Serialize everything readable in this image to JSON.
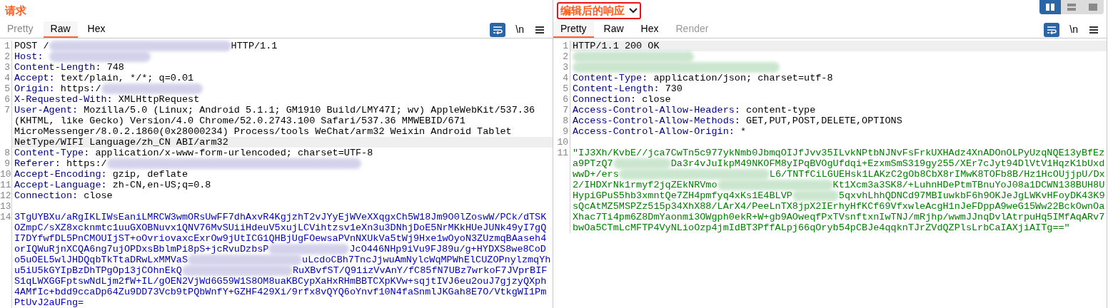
{
  "panes": [
    {
      "title": "请求",
      "title_boxed": false,
      "tabs": [
        {
          "label": "Pretty",
          "selected": false,
          "disabled": false
        },
        {
          "label": "Raw",
          "selected": true,
          "disabled": false
        },
        {
          "label": "Hex",
          "selected": false,
          "disabled": false
        }
      ],
      "toolbar": {
        "wrap_on": true,
        "newline": "\\n"
      },
      "lines": [
        {
          "number": "1",
          "highlighted": false,
          "rows": [
            [
              {
                "kind": "text",
                "text": "POST /"
              },
              {
                "kind": "redacted"
              },
              {
                "kind": "text",
                "text": "HTTP/1.1"
              }
            ]
          ]
        },
        {
          "number": "2",
          "highlighted": false,
          "rows": [
            [
              {
                "kind": "name",
                "text": "Host: "
              },
              {
                "kind": "redacted"
              }
            ]
          ]
        },
        {
          "number": "3",
          "highlighted": false,
          "rows": [
            [
              {
                "kind": "name",
                "text": "Content-Length: "
              },
              {
                "kind": "text",
                "text": "748"
              }
            ]
          ]
        },
        {
          "number": "4",
          "highlighted": false,
          "rows": [
            [
              {
                "kind": "name",
                "text": "Accept: "
              },
              {
                "kind": "text",
                "text": "text/plain, */*; q=0.01"
              }
            ]
          ]
        },
        {
          "number": "5",
          "highlighted": false,
          "rows": [
            [
              {
                "kind": "name",
                "text": "Origin: "
              },
              {
                "kind": "text",
                "text": "https:/"
              },
              {
                "kind": "redacted"
              }
            ]
          ]
        },
        {
          "number": "6",
          "highlighted": false,
          "rows": [
            [
              {
                "kind": "name",
                "text": "X-Requested-With: "
              },
              {
                "kind": "text",
                "text": "XMLHttpRequest"
              }
            ]
          ]
        },
        {
          "number": "7",
          "highlighted": true,
          "rows": [
            [
              {
                "kind": "name",
                "text": "User-Agent: "
              },
              {
                "kind": "text",
                "text": "Mozilla/5.0 (Linux; Android 5.1.1; GM1910 Build/LMY47I; wv) AppleWebKit/537.36"
              }
            ],
            [
              {
                "kind": "text",
                "text": "(KHTML, like Gecko) Version/4.0 Chrome/52.0.2743.100 Safari/537.36 MMWEBID/671"
              }
            ],
            [
              {
                "kind": "text",
                "text": "MicroMessenger/8.0.2.1860(0x28000234) Process/tools WeChat/arm32 Weixin Android Tablet"
              }
            ],
            [
              {
                "kind": "text",
                "text": "NetType/WIFI Language/zh_CN ABI/arm32"
              }
            ]
          ]
        },
        {
          "number": "8",
          "highlighted": false,
          "rows": [
            [
              {
                "kind": "name",
                "text": "Content-Type: "
              },
              {
                "kind": "text",
                "text": "application/x-www-form-urlencoded; charset=UTF-8"
              }
            ]
          ]
        },
        {
          "number": "9",
          "highlighted": false,
          "rows": [
            [
              {
                "kind": "name",
                "text": "Referer: "
              },
              {
                "kind": "text",
                "text": "https:/"
              },
              {
                "kind": "redacted"
              }
            ]
          ]
        },
        {
          "number": "10",
          "highlighted": false,
          "rows": [
            [
              {
                "kind": "name",
                "text": "Accept-Encoding: "
              },
              {
                "kind": "text",
                "text": "gzip, deflate"
              }
            ]
          ]
        },
        {
          "number": "11",
          "highlighted": false,
          "rows": [
            [
              {
                "kind": "name",
                "text": "Accept-Language: "
              },
              {
                "kind": "text",
                "text": "zh-CN,en-US;q=0.8"
              }
            ]
          ]
        },
        {
          "number": "12",
          "highlighted": false,
          "rows": [
            [
              {
                "kind": "name",
                "text": "Connection: "
              },
              {
                "kind": "text",
                "text": "close"
              }
            ]
          ]
        },
        {
          "number": "13",
          "highlighted": false,
          "rows": [
            []
          ]
        },
        {
          "number": "14",
          "highlighted": false,
          "rows": [
            [
              {
                "kind": "body",
                "text": "3TgUYBXu/aRgIKLIWsEaniLMRCW3wmORsUwFF7dhAxvR4KgjzhT2vJYyEjWVeXXqgxCh5W18Jm9O0lZoswW/PCk/dTSK"
              }
            ],
            [
              {
                "kind": "body",
                "text": "OZmpC/sXZ8xcknmtc1uuGXOBNuvx1QNV76MvSUiiHdeuV5xujLCVihtzsv1eXn3u3DNhjDoE5NrMKkHUeJUNk49yI7gQ"
              }
            ],
            [
              {
                "kind": "body",
                "text": "I7DYfwfDL5PnCMOUIjST+oOvriovaxcExrOw9jUtICG1QHBjUgFOewsaPVnNXUkVa5tWj9Hxe1wOyoN3ZUzmqBAaseh4"
              }
            ],
            [
              {
                "kind": "body",
                "text": "orIQWuRjnXCQA6ng7ujOPDxsBblmPi8pS+jcRvuDzbsP"
              },
              {
                "kind": "redacted"
              },
              {
                "kind": "body",
                "text": "JcO446NHp9iVu9FJ89u/g+HYDXS8we8CoD"
              }
            ],
            [
              {
                "kind": "body",
                "text": "o5uOEL5wlJHDQqbTkTtaDRwLxMMVaS"
              },
              {
                "kind": "redacted"
              },
              {
                "kind": "body",
                "text": "uLcdoCBh7TncJjwuAmNylcWqMPWhElCUZOPnylzmqYh"
              }
            ],
            [
              {
                "kind": "body",
                "text": "u5iU5kGYIpBzDhTPgOp13jCOhnEkQ"
              },
              {
                "kind": "redacted"
              },
              {
                "kind": "body",
                "text": "RuXBvfST/Q91izVvAnY/fC85fN7UBz7wrkoF7JVprBIF"
              }
            ],
            [
              {
                "kind": "body",
                "text": "S1qLWXGGFptswNdLjm2fW+IL/gOEN2VjWd6G59W1S8OM8uaKBCypXaHxRHmBBTCXpKVw+sqjtIVJ6eu2ouJ7gjzyQXph"
              }
            ],
            [
              {
                "kind": "body",
                "text": "4AMfIc+bdd9ccaDp64Zu9DD73Vcb9tPQbWnfY+GZHF429Xi/9rfx8vQYQ6oYnvf10N4faSnmlJKGah8E7O/VtkgWI1Pm"
              }
            ],
            [
              {
                "kind": "body",
                "text": "PtUvJ2aUFng="
              }
            ]
          ]
        }
      ]
    },
    {
      "title": "编辑后的响应",
      "title_boxed": true,
      "tabs": [
        {
          "label": "Pretty",
          "selected": true,
          "disabled": false
        },
        {
          "label": "Raw",
          "selected": false,
          "disabled": false
        },
        {
          "label": "Hex",
          "selected": false,
          "disabled": false
        },
        {
          "label": "Render",
          "selected": false,
          "disabled": true
        }
      ],
      "toolbar": {
        "wrap_on": true,
        "newline": "\\n"
      },
      "lines": [
        {
          "number": "1",
          "highlighted": true,
          "rows": [
            [
              {
                "kind": "text",
                "text": "HTTP/1.1 200 OK"
              }
            ]
          ]
        },
        {
          "number": "2",
          "highlighted": false,
          "rows": [
            [
              {
                "kind": "redacted"
              }
            ]
          ]
        },
        {
          "number": "3",
          "highlighted": false,
          "rows": [
            [
              {
                "kind": "redacted"
              }
            ]
          ]
        },
        {
          "number": "4",
          "highlighted": false,
          "rows": [
            [
              {
                "kind": "name",
                "text": "Content-Type: "
              },
              {
                "kind": "text",
                "text": "application/json; charset=utf-8"
              }
            ]
          ]
        },
        {
          "number": "5",
          "highlighted": false,
          "rows": [
            [
              {
                "kind": "name",
                "text": "Content-Length: "
              },
              {
                "kind": "text",
                "text": "730"
              }
            ]
          ]
        },
        {
          "number": "6",
          "highlighted": false,
          "rows": [
            [
              {
                "kind": "name",
                "text": "Connection: "
              },
              {
                "kind": "text",
                "text": "close"
              }
            ]
          ]
        },
        {
          "number": "7",
          "highlighted": false,
          "rows": [
            [
              {
                "kind": "name",
                "text": "Access-Control-Allow-Headers: "
              },
              {
                "kind": "text",
                "text": "content-type"
              }
            ]
          ]
        },
        {
          "number": "8",
          "highlighted": false,
          "rows": [
            [
              {
                "kind": "name",
                "text": "Access-Control-Allow-Methods: "
              },
              {
                "kind": "text",
                "text": "GET,PUT,POST,DELETE,OPTIONS"
              }
            ]
          ]
        },
        {
          "number": "9",
          "highlighted": false,
          "rows": [
            [
              {
                "kind": "name",
                "text": "Access-Control-Allow-Origin: "
              },
              {
                "kind": "text",
                "text": "*"
              }
            ]
          ]
        },
        {
          "number": "10",
          "highlighted": false,
          "rows": [
            []
          ]
        },
        {
          "number": "11",
          "highlighted": false,
          "rows": [
            [
              {
                "kind": "body",
                "text": "\"IJ3Xh/KvbE//jca7CwTn5c977ykNmb0JbmqOIJfJvv35ILvkNPtbNJNvFsFrkUXHAdz4XnADOnOLPyUzqNQE13yBfEz"
              }
            ],
            [
              {
                "kind": "body",
                "text": "a9PTzQ7"
              },
              {
                "kind": "redacted"
              },
              {
                "kind": "body",
                "text": "Da3r4vJuIkpM49NKOFM8yIPqBVOgUfdqi+EzxmSmS319gy255/XEr7cJyt94DlVtV1HqzK1bUxd"
              }
            ],
            [
              {
                "kind": "body",
                "text": "wwD+/ers"
              },
              {
                "kind": "redacted"
              },
              {
                "kind": "body",
                "text": "L6/TNTfCiLGUEHsk1LAKzC2gOb8CbX8rIMwK8TOFb8B/Hz1HcOUjjpU/Dx"
              }
            ],
            [
              {
                "kind": "body",
                "text": "2/IHDXrNk1rmyf2jqZEkNRVmo"
              },
              {
                "kind": "redacted"
              },
              {
                "kind": "body",
                "text": "Kt1Xcm3a3SK8/+LuhnHDePtmTBnuYoJ08a1DCWN138BUH8U"
              }
            ],
            [
              {
                "kind": "body",
                "text": "HypiGPuS5hb3xmntQe7ZH4pmfyq4xKs1E4BLVP"
              },
              {
                "kind": "redacted"
              },
              {
                "kind": "body",
                "text": "5qxvhLhhQDNCd97MBIuwkbF6h9OKJeJgLWKvHFoyDK43K9"
              }
            ],
            [
              {
                "kind": "body",
                "text": "sQcAtMZ5MSPZz515p34XhX88/LArX4/PeeLnTX8jpX2IErhyHfKCf69VfxwleAcgH1nJeFDppA9weG15Ww22BckOwnOa"
              }
            ],
            [
              {
                "kind": "body",
                "text": "Xhac7Ti4pm6Z8DmYaonmi3OWgph0ekR+W+gb9AOweqfPxTVsnftxnIwTNJ/mRjhp/wwmJJnqDvlAtrpuHq5IMfAqARv7"
              }
            ],
            [
              {
                "kind": "body",
                "text": "bwOa5CTmLcMFTP4VyNLioOzp4jmIdBT3PffALpj66qOryb54pCBJe4qqknTJrZVdQZPlsLrbCaIAXjiAITg==\""
              }
            ]
          ]
        }
      ]
    }
  ],
  "layout_buttons": [
    {
      "selected": true
    },
    {
      "selected": false
    },
    {
      "selected": false
    }
  ]
}
